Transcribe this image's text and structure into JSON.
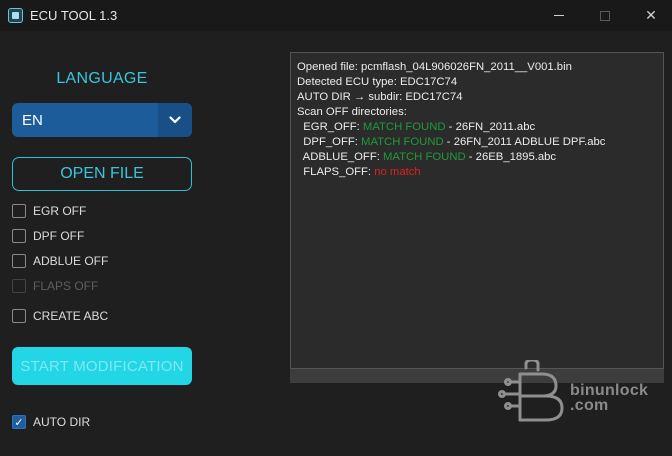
{
  "window": {
    "title": "ECU TOOL 1.3",
    "min_glyph": "",
    "close_glyph": "✕"
  },
  "language": {
    "label": "LANGUAGE",
    "selected": "EN",
    "arrow_glyph": "⌄"
  },
  "buttons": {
    "open_file": "OPEN FILE",
    "start_modification": "START MODIFICATION"
  },
  "options": [
    {
      "label": "EGR OFF",
      "checked": false,
      "enabled": true
    },
    {
      "label": "DPF OFF",
      "checked": false,
      "enabled": true
    },
    {
      "label": "ADBLUE OFF",
      "checked": false,
      "enabled": true
    },
    {
      "label": "FLAPS OFF",
      "checked": false,
      "enabled": false
    },
    {
      "label": "CREATE ABC",
      "checked": false,
      "enabled": true
    }
  ],
  "auto_dir": {
    "label": "AUTO DIR",
    "checked": true,
    "check_glyph": "✓"
  },
  "log": {
    "line1": "Opened file: pcmflash_04L906026FN_2011__V001.bin",
    "line2": "Detected ECU type: EDC17C74",
    "line3": "AUTO DIR → subdir: EDC17C74",
    "line4": "Scan OFF directories:",
    "egr_prefix": "  EGR_OFF: ",
    "egr_status": "MATCH FOUND",
    "egr_file": " - 26FN_2011.abc",
    "dpf_prefix": "  DPF_OFF: ",
    "dpf_status": "MATCH FOUND",
    "dpf_file": " - 26FN_2011 ADBLUE DPF.abc",
    "adblue_prefix": "  ADBLUE_OFF: ",
    "adblue_status": "MATCH FOUND",
    "adblue_file": " - 26EB_1895.abc",
    "flaps_prefix": "  FLAPS_OFF: ",
    "flaps_status": "no match"
  },
  "watermark": {
    "line1": "binunlock",
    "line2": ".com"
  },
  "colors": {
    "accent": "#39c6dc",
    "select_bg": "#1d5c9a",
    "start_bg": "#22d6e6",
    "match": "#1f9a3b",
    "no_match": "#e02020"
  }
}
